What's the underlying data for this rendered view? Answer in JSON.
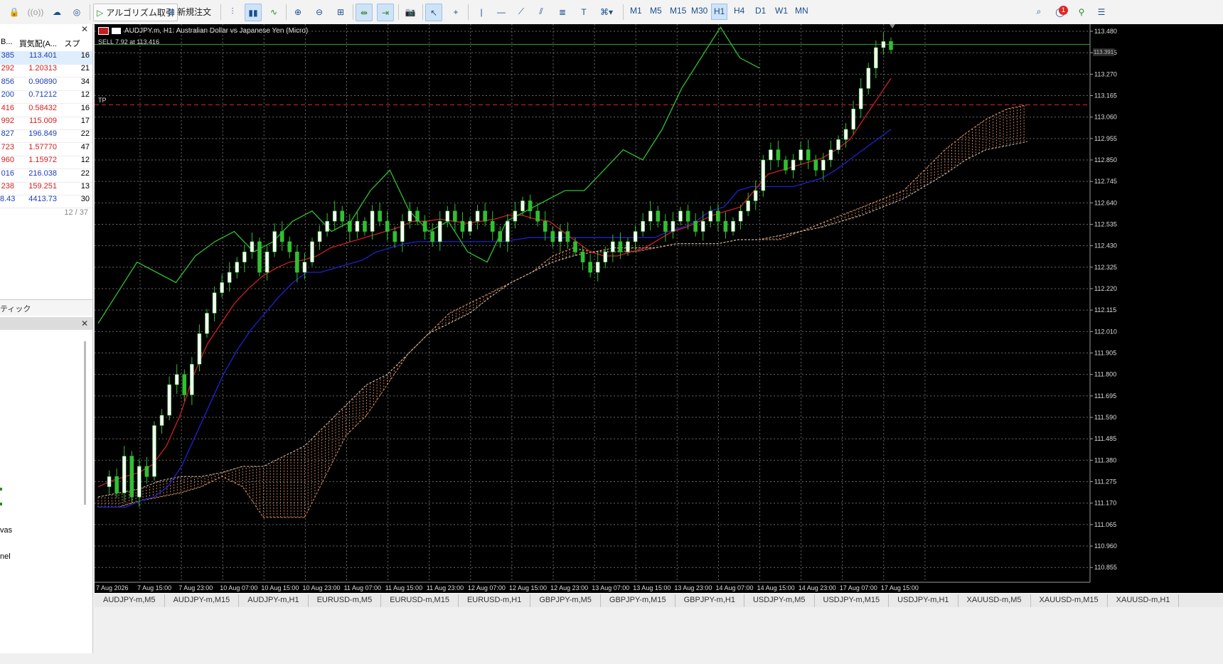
{
  "toolbar": {
    "algo_trading": "アルゴリズム取引",
    "new_order": "新規注文",
    "timeframes": [
      "M1",
      "M5",
      "M15",
      "M30",
      "H1",
      "H4",
      "D1",
      "W1",
      "MN"
    ],
    "active_timeframe": "H1",
    "notification_count": "1"
  },
  "market_watch": {
    "headers": [
      "B...",
      "買気配(A...",
      "スプレ..."
    ],
    "rows": [
      {
        "bid": "385",
        "ask": "113.401",
        "spread": "16",
        "color": "#1f3fb5"
      },
      {
        "bid": "292",
        "ask": "1.20313",
        "spread": "21",
        "color": "#d32020"
      },
      {
        "bid": "856",
        "ask": "0.90890",
        "spread": "34",
        "color": "#1f3fb5"
      },
      {
        "bid": "200",
        "ask": "0.71212",
        "spread": "12",
        "color": "#1f3fb5"
      },
      {
        "bid": "416",
        "ask": "0.58432",
        "spread": "16",
        "color": "#d32020"
      },
      {
        "bid": "992",
        "ask": "115.009",
        "spread": "17",
        "color": "#d32020"
      },
      {
        "bid": "827",
        "ask": "196.849",
        "spread": "22",
        "color": "#1f3fb5"
      },
      {
        "bid": "723",
        "ask": "1.57770",
        "spread": "47",
        "color": "#d32020"
      },
      {
        "bid": "960",
        "ask": "1.15972",
        "spread": "12",
        "color": "#d32020"
      },
      {
        "bid": "016",
        "ask": "216.038",
        "spread": "22",
        "color": "#1f3fb5"
      },
      {
        "bid": "238",
        "ask": "159.251",
        "spread": "13",
        "color": "#d32020"
      },
      {
        "bid": "8.43",
        "ask": "4413.73",
        "spread": "30",
        "color": "#1f3fb5"
      }
    ],
    "count": "12 / 37",
    "tick_tab": "ティック"
  },
  "navigator": {
    "partial_items": [
      "vas",
      "nel"
    ]
  },
  "chart_info": {
    "title": "AUDJPY.m, H1:  Australian Dollar vs Japanese Yen (Micro)",
    "trade_label": "SELL 7.92 at 113.416",
    "tp_label": "TP",
    "current_price": "113.391"
  },
  "chart_data": {
    "type": "candlestick",
    "symbol": "AUDJPY.m",
    "timeframe": "H1",
    "ylim": [
      110.8,
      113.48
    ],
    "y_ticks": [
      "113.480",
      "113.375",
      "113.270",
      "113.165",
      "113.060",
      "112.955",
      "112.850",
      "112.745",
      "112.640",
      "112.535",
      "112.430",
      "112.325",
      "112.220",
      "112.115",
      "112.010",
      "111.905",
      "111.800",
      "111.695",
      "111.590",
      "111.485",
      "111.380",
      "111.275",
      "111.170",
      "111.065",
      "110.960",
      "110.855"
    ],
    "x_ticks": [
      "7 Aug 2026",
      "7 Aug 15:00",
      "7 Aug 23:00",
      "10 Aug 07:00",
      "10 Aug 15:00",
      "10 Aug 23:00",
      "11 Aug 07:00",
      "11 Aug 15:00",
      "11 Aug 23:00",
      "12 Aug 07:00",
      "12 Aug 15:00",
      "12 Aug 23:00",
      "13 Aug 07:00",
      "13 Aug 15:00",
      "13 Aug 23:00",
      "14 Aug 07:00",
      "14 Aug 15:00",
      "14 Aug 23:00",
      "17 Aug 07:00",
      "17 Aug 15:00"
    ],
    "close_path": [
      111.25,
      111.3,
      111.22,
      111.4,
      111.2,
      111.35,
      111.3,
      111.55,
      111.6,
      111.75,
      111.8,
      111.7,
      111.85,
      112.0,
      112.1,
      112.2,
      112.25,
      112.3,
      112.35,
      112.4,
      112.45,
      112.3,
      112.4,
      112.5,
      112.45,
      112.4,
      112.3,
      112.35,
      112.45,
      112.5,
      112.55,
      112.6,
      112.55,
      112.5,
      112.55,
      112.5,
      112.6,
      112.55,
      112.5,
      112.45,
      112.55,
      112.6,
      112.55,
      112.5,
      112.45,
      112.55,
      112.6,
      112.55,
      112.5,
      112.55,
      112.6,
      112.55,
      112.5,
      112.45,
      112.55,
      112.6,
      112.65,
      112.6,
      112.55,
      112.5,
      112.45,
      112.5,
      112.45,
      112.4,
      112.35,
      112.3,
      112.35,
      112.4,
      112.45,
      112.4,
      112.45,
      112.5,
      112.55,
      112.6,
      112.55,
      112.5,
      112.55,
      112.6,
      112.55,
      112.5,
      112.55,
      112.6,
      112.55,
      112.5,
      112.55,
      112.6,
      112.65,
      112.7,
      112.85,
      112.9,
      112.85,
      112.8,
      112.85,
      112.9,
      112.85,
      112.8,
      112.85,
      112.9,
      112.95,
      113.0,
      113.1,
      113.2,
      113.3,
      113.4,
      113.43,
      113.39
    ],
    "tenkan": [
      111.25,
      111.28,
      111.3,
      111.32,
      111.36,
      111.45,
      111.6,
      111.8,
      111.95,
      112.05,
      112.15,
      112.22,
      112.28,
      112.32,
      112.35,
      112.36,
      112.38,
      112.42,
      112.44,
      112.46,
      112.48,
      112.5,
      112.52,
      112.55,
      112.55,
      112.56,
      112.55,
      112.54,
      112.55,
      112.56,
      112.58,
      112.58,
      112.56,
      112.55,
      112.5,
      112.45,
      112.4,
      112.38,
      112.38,
      112.4,
      112.42,
      112.46,
      112.5,
      112.52,
      112.55,
      112.58,
      112.6,
      112.62,
      112.7,
      112.78,
      112.8,
      112.82,
      112.84,
      112.86,
      112.9,
      112.95,
      113.05,
      113.15,
      113.25
    ],
    "kijun": [
      111.15,
      111.15,
      111.15,
      111.18,
      111.2,
      111.25,
      111.35,
      111.5,
      111.65,
      111.8,
      111.92,
      112.02,
      112.1,
      112.18,
      112.25,
      112.3,
      112.3,
      112.32,
      112.34,
      112.36,
      112.4,
      112.42,
      112.44,
      112.45,
      112.45,
      112.45,
      112.45,
      112.45,
      112.45,
      112.45,
      112.46,
      112.47,
      112.47,
      112.47,
      112.47,
      112.47,
      112.47,
      112.47,
      112.47,
      112.47,
      112.47,
      112.5,
      112.52,
      112.55,
      112.6,
      112.62,
      112.7,
      112.72,
      112.72,
      112.72,
      112.72,
      112.74,
      112.76,
      112.8,
      112.85,
      112.9,
      112.95,
      113.0
    ],
    "chikou": [
      112.05,
      112.2,
      112.35,
      112.3,
      112.25,
      112.38,
      112.45,
      112.5,
      112.4,
      112.45,
      112.55,
      112.6,
      112.5,
      112.55,
      112.7,
      112.8,
      112.6,
      112.5,
      112.55,
      112.4,
      112.35,
      112.55,
      112.6,
      112.65,
      112.7,
      112.7,
      112.8,
      112.9,
      112.85,
      113.0,
      113.2,
      113.35,
      113.5,
      113.35,
      113.3
    ],
    "span_a": [
      111.15,
      111.15,
      111.18,
      111.2,
      111.22,
      111.25,
      111.3,
      111.25,
      111.1,
      111.1,
      111.1,
      111.3,
      111.5,
      111.6,
      111.75,
      111.9,
      112.0,
      112.1,
      112.15,
      112.2,
      112.25,
      112.3,
      112.38,
      112.42,
      112.4,
      112.4,
      112.4,
      112.42,
      112.44,
      112.44,
      112.44,
      112.46,
      112.46,
      112.46,
      112.5,
      112.54,
      112.58,
      112.62,
      112.66,
      112.7,
      112.8,
      112.9,
      112.98,
      113.05,
      113.1,
      113.12
    ],
    "span_b": [
      111.2,
      111.22,
      111.24,
      111.28,
      111.3,
      111.3,
      111.32,
      111.35,
      111.35,
      111.4,
      111.45,
      111.55,
      111.65,
      111.75,
      111.8,
      111.9,
      112.0,
      112.05,
      112.1,
      112.18,
      112.25,
      112.3,
      112.35,
      112.38,
      112.4,
      112.42,
      112.42,
      112.42,
      112.44,
      112.44,
      112.44,
      112.46,
      112.46,
      112.48,
      112.5,
      112.52,
      112.55,
      112.58,
      112.62,
      112.66,
      112.72,
      112.78,
      112.85,
      112.9,
      112.92,
      112.94
    ],
    "hlines": [
      {
        "label": "TP",
        "value": 113.12
      },
      {
        "label": "SELL",
        "value": 113.416
      }
    ]
  },
  "tabs": [
    "AUDJPY-m,M5",
    "AUDJPY-m,M15",
    "AUDJPY-m,H1",
    "EURUSD-m,M5",
    "EURUSD-m,M15",
    "EURUSD-m,H1",
    "GBPJPY-m,M5",
    "GBPJPY-m,M15",
    "GBPJPY-m,H1",
    "USDJPY-m,M5",
    "USDJPY-m,M15",
    "USDJPY-m,H1",
    "XAUUSD-m,M5",
    "XAUUSD-m,M15",
    "XAUUSD-m,H1"
  ]
}
